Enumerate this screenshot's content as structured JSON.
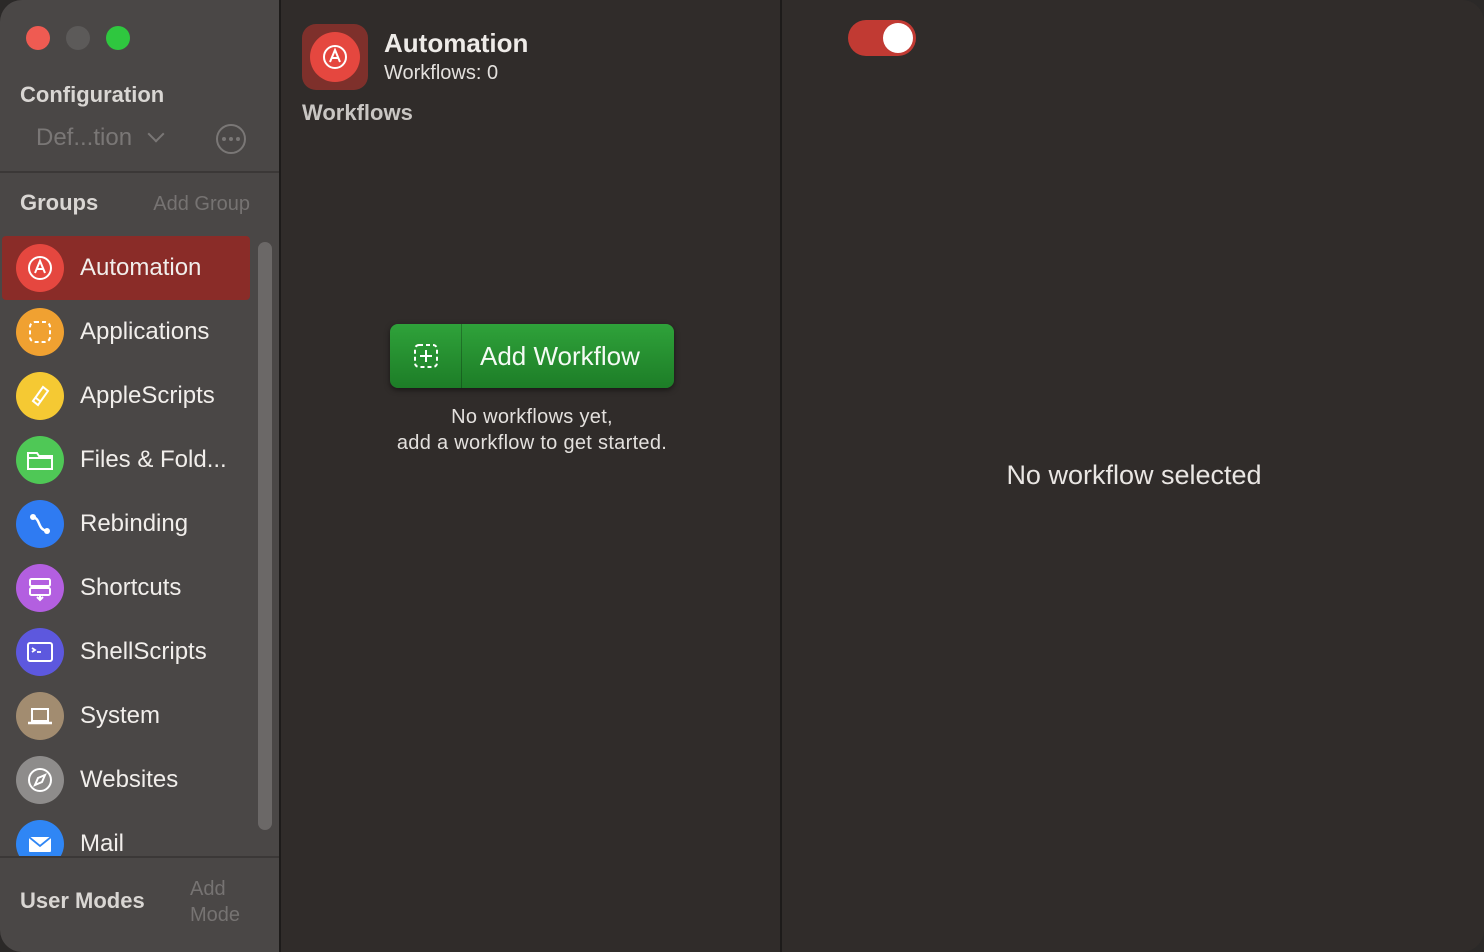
{
  "sidebar": {
    "configuration_title": "Configuration",
    "configuration_value": "Def...tion",
    "groups_title": "Groups",
    "add_group_label": "Add Group",
    "groups": [
      {
        "label": "Automation",
        "icon": "automation-icon",
        "color": "#e5473f",
        "selected": true
      },
      {
        "label": "Applications",
        "icon": "applications-icon",
        "color": "#f0a131"
      },
      {
        "label": "AppleScripts",
        "icon": "applescript-icon",
        "color": "#f5c933"
      },
      {
        "label": "Files & Fold...",
        "icon": "folder-icon",
        "color": "#4fc856"
      },
      {
        "label": "Rebinding",
        "icon": "rebinding-icon",
        "color": "#2f7bf2"
      },
      {
        "label": "Shortcuts",
        "icon": "shortcuts-icon",
        "color": "#b35fe0"
      },
      {
        "label": "ShellScripts",
        "icon": "terminal-icon",
        "color": "#5d58de"
      },
      {
        "label": "System",
        "icon": "laptop-icon",
        "color": "#a28c70"
      },
      {
        "label": "Websites",
        "icon": "compass-icon",
        "color": "#8e8c8b"
      },
      {
        "label": "Mail",
        "icon": "mail-icon",
        "color": "#2f86f5"
      }
    ],
    "user_modes_title": "User Modes",
    "add_mode_label": "Add Mode"
  },
  "middle": {
    "group_title": "Automation",
    "workflow_count": "Workflows: 0",
    "section_label": "Workflows",
    "add_workflow_label": "Add Workflow",
    "empty_line1": "No workflows yet,",
    "empty_line2": "add a workflow to get started."
  },
  "detail": {
    "toggle_on": true,
    "empty_text": "No workflow selected"
  },
  "colors": {
    "accent_red": "#c13a33",
    "button_green": "#2a9a35",
    "sidebar_bg": "#4a4746",
    "content_bg": "#302c2a"
  }
}
